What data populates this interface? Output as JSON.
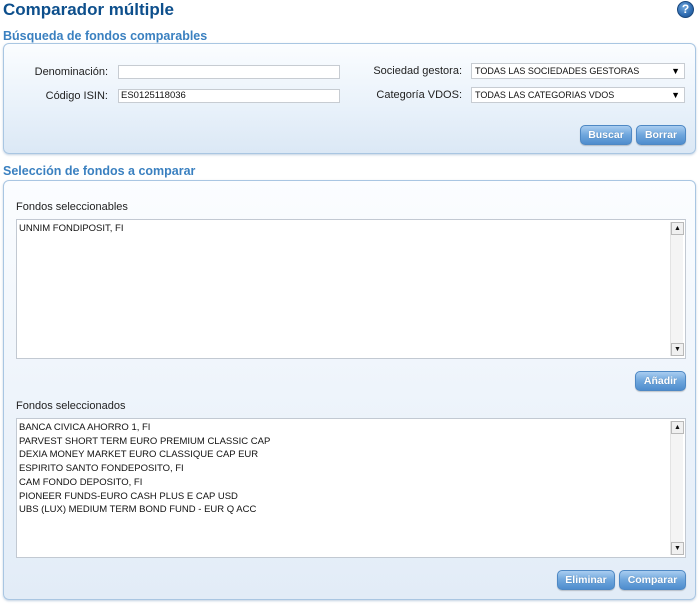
{
  "header": {
    "title": "Comparador múltiple",
    "help_label": "?"
  },
  "search": {
    "section_title": "Búsqueda de fondos comparables",
    "denominacion_label": "Denominación:",
    "denominacion_value": "",
    "isin_label": "Código ISIN:",
    "isin_value": "ES0125118036",
    "sociedad_label": "Sociedad gestora:",
    "sociedad_value": "TODAS LAS SOCIEDADES GESTORAS",
    "categoria_label": "Categoría VDOS:",
    "categoria_value": "TODAS LAS CATEGORIAS VDOS",
    "buscar_label": "Buscar",
    "borrar_label": "Borrar"
  },
  "selection": {
    "section_title": "Selección de fondos a comparar",
    "selectable_label": "Fondos seleccionables",
    "selectable_items": [
      "UNNIM FONDIPOSIT, FI"
    ],
    "add_label": "Añadir",
    "selected_label": "Fondos seleccionados",
    "selected_items": [
      "BANCA CIVICA AHORRO 1, FI",
      "PARVEST SHORT TERM EURO PREMIUM CLASSIC CAP",
      "DEXIA MONEY MARKET EURO CLASSIQUE CAP EUR",
      "ESPIRITO SANTO FONDEPOSITO, FI",
      "CAM FONDO DEPOSITO, FI",
      "PIONEER FUNDS-EURO CASH PLUS E CAP USD",
      "UBS (LUX) MEDIUM TERM BOND FUND - EUR Q ACC"
    ],
    "remove_label": "Eliminar",
    "compare_label": "Comparar"
  },
  "icons": {
    "help": "help-icon",
    "dropdown": "chevron-down-icon",
    "scroll_up": "arrow-up-icon",
    "scroll_down": "arrow-down-icon"
  }
}
